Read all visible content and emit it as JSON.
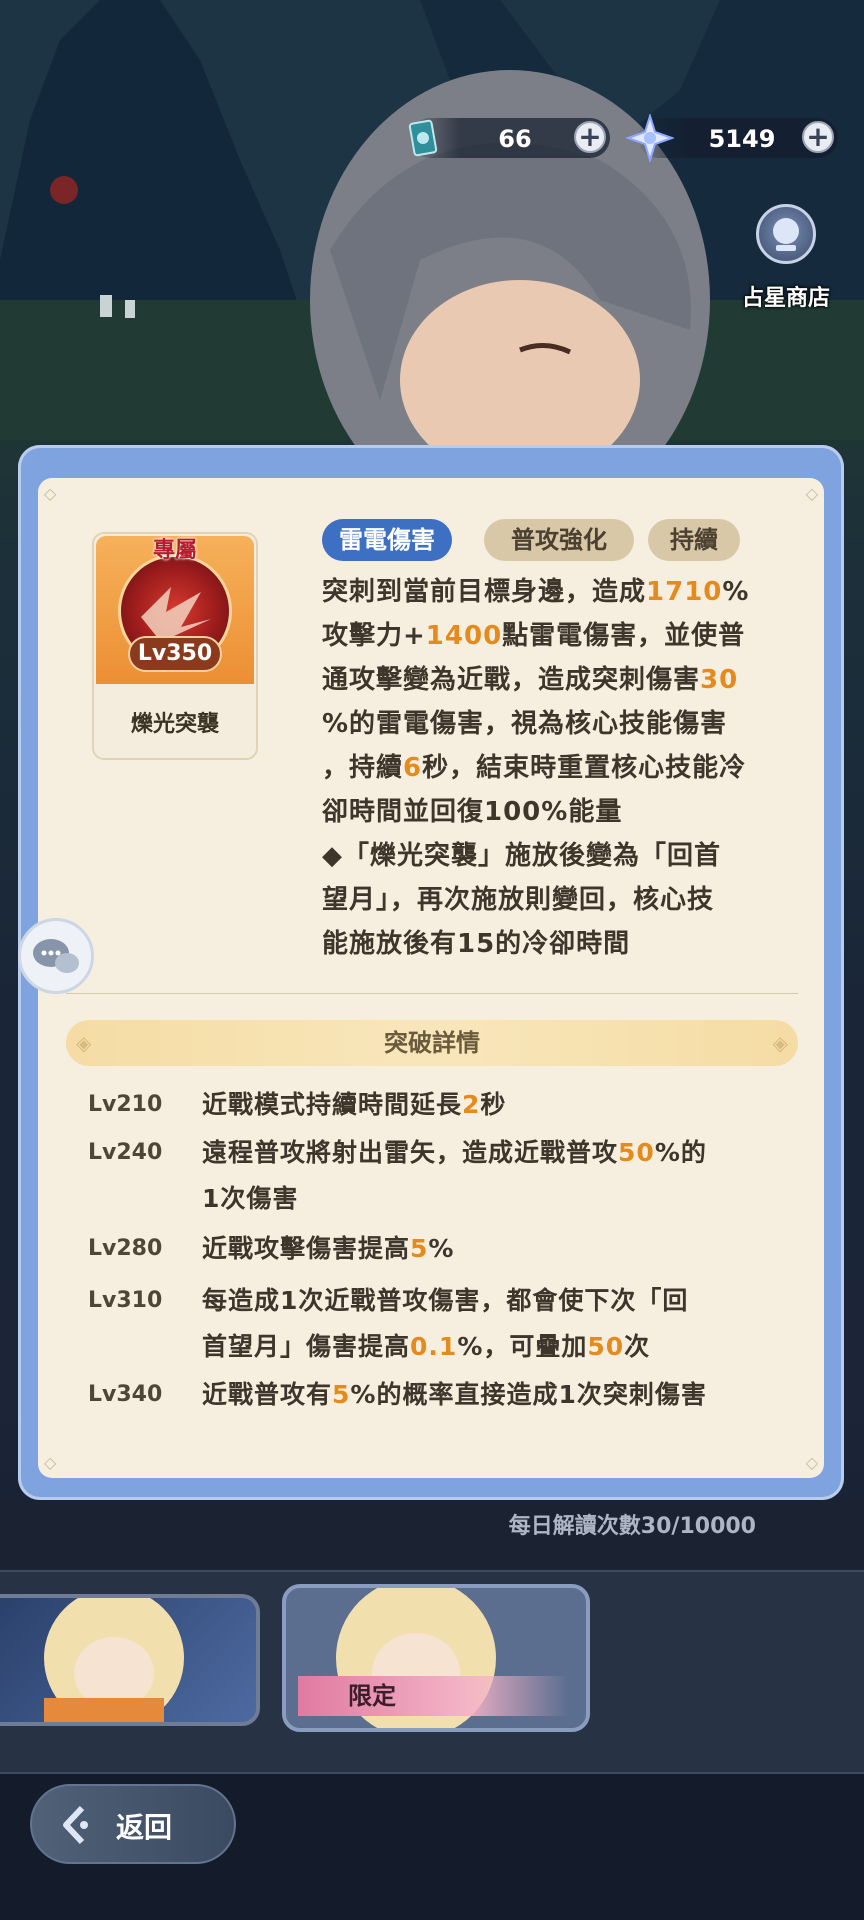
{
  "currency": {
    "ticket": {
      "value": "66",
      "icon": "card-ticket-icon"
    },
    "star": {
      "value": "5149",
      "icon": "star-crystal-icon"
    }
  },
  "shop": {
    "label": "占星商店",
    "icon": "crystal-ball-icon"
  },
  "skill": {
    "exclusive_tag": "專屬",
    "level": "Lv350",
    "name": "爍光突襲",
    "tags": [
      "雷電傷害",
      "普攻強化",
      "持續"
    ],
    "description_lines": [
      [
        "突刺到當前目標身邊，造成",
        "1710",
        "%"
      ],
      [
        "攻擊力+",
        "1400",
        "點雷電傷害，並使普"
      ],
      [
        "通攻擊變為近戰，造成突刺傷害",
        "30",
        ""
      ],
      [
        "%的雷電傷害，視為核心技能傷害",
        "",
        ""
      ],
      [
        "，持續",
        "6",
        "秒，結束時重置核心技能冷"
      ],
      [
        "卻時間並回復100%能量",
        "",
        ""
      ],
      [
        "◆「爍光突襲」施放後變為「回首",
        "",
        ""
      ],
      [
        "望月」，再次施放則變回，核心技",
        "",
        ""
      ],
      [
        "能施放後有15的冷卻時間",
        "",
        ""
      ]
    ]
  },
  "breakthrough": {
    "header": "突破詳情",
    "rows": [
      {
        "level": "Lv210",
        "lines": [
          [
            "近戰模式持續時間延長",
            "2",
            "秒"
          ]
        ]
      },
      {
        "level": "Lv240",
        "lines": [
          [
            "遠程普攻將射出雷矢，造成近戰普攻",
            "50",
            "%的"
          ],
          [
            "1次傷害",
            "",
            ""
          ]
        ]
      },
      {
        "level": "Lv280",
        "lines": [
          [
            "近戰攻擊傷害提高",
            "5",
            "%"
          ]
        ]
      },
      {
        "level": "Lv310",
        "lines": [
          [
            "每造成1次近戰普攻傷害，都會使下次「回",
            "",
            ""
          ],
          [
            "首望月」傷害提高",
            "0.1",
            "%，可疊加"
          ],
          [
            "",
            "50",
            "次"
          ]
        ]
      },
      {
        "level": "Lv340",
        "lines": [
          [
            "近戰普攻有",
            "5",
            "%的概率直接造成1次突刺傷害"
          ]
        ]
      }
    ]
  },
  "daily_reads": "每日解讀次數30/10000",
  "characters": [
    {
      "name": "character-card-1",
      "selected": false
    },
    {
      "name": "character-card-2",
      "selected": true,
      "badge": "限定"
    }
  ],
  "back_label": "返回",
  "colors": {
    "accent": "#e58a1c",
    "panel_frame": "#7fa3de",
    "panel_bg": "#f6efe0",
    "tag_blue": "#3d6fc2",
    "tag_tan": "#d8c8a8"
  }
}
